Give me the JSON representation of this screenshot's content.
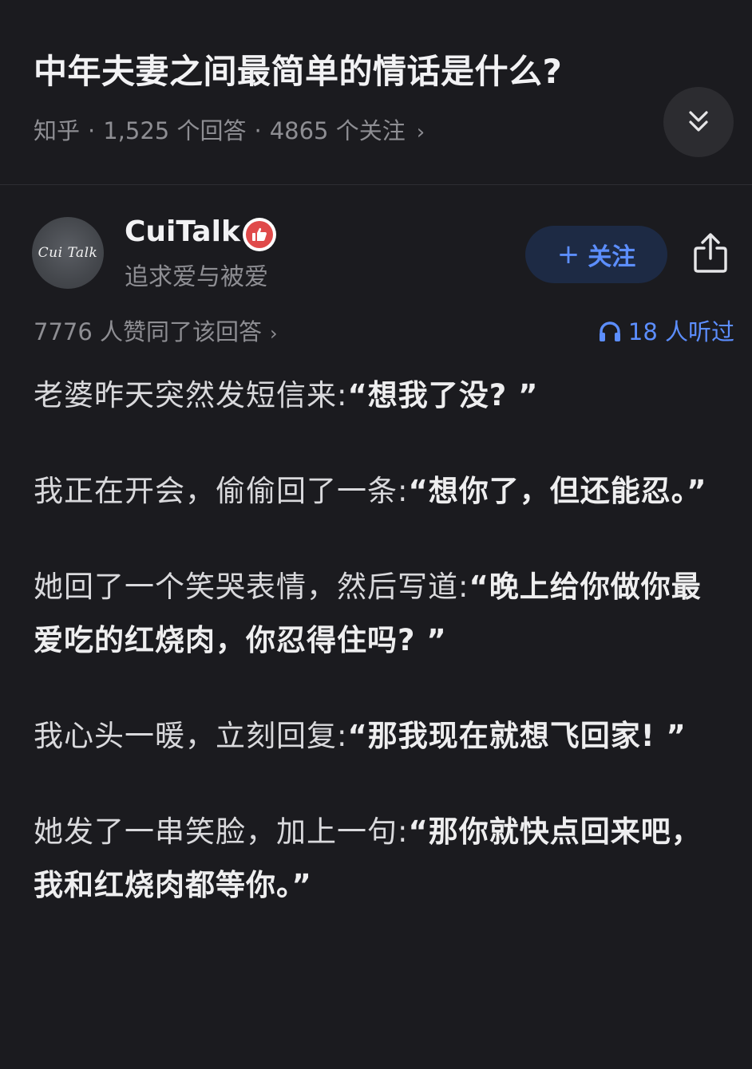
{
  "question": {
    "title": "中年夫妻之间最简单的情话是什么?",
    "source": "知乎",
    "answers": "1,525 个回答",
    "followers": "4865 个关注",
    "chevron": "›"
  },
  "author": {
    "avatar_text": "Cui Talk",
    "name": "CuiTalk",
    "bio": "追求爱与被爱",
    "badge_icon": "thumbs-up-badge-icon",
    "follow_label": "关注",
    "follow_plus": "+"
  },
  "stats": {
    "likes": "7776 人赞同了该回答",
    "chevron": "›",
    "listeners": "18 人听过"
  },
  "answer": [
    {
      "plain": "老婆昨天突然发短信来:",
      "bold": "“想我了没? ”"
    },
    {
      "plain": "我正在开会，偷偷回了一条:",
      "bold": "“想你了，但还能忍。”"
    },
    {
      "plain": "她回了一个笑哭表情，然后写道:",
      "bold": "“晚上给你做你最爱吃的红烧肉，你忍得住吗? ”"
    },
    {
      "plain": "我心头一暖，立刻回复:",
      "bold": "“那我现在就想飞回家! ”"
    },
    {
      "plain": "她发了一串笑脸，加上一句:",
      "bold": "“那你就快点回来吧，我和红烧肉都等你。”"
    }
  ],
  "colors": {
    "background": "#1b1b1f",
    "accent": "#5c8eff",
    "badge": "#e04a4a",
    "muted": "#8e8e93"
  }
}
